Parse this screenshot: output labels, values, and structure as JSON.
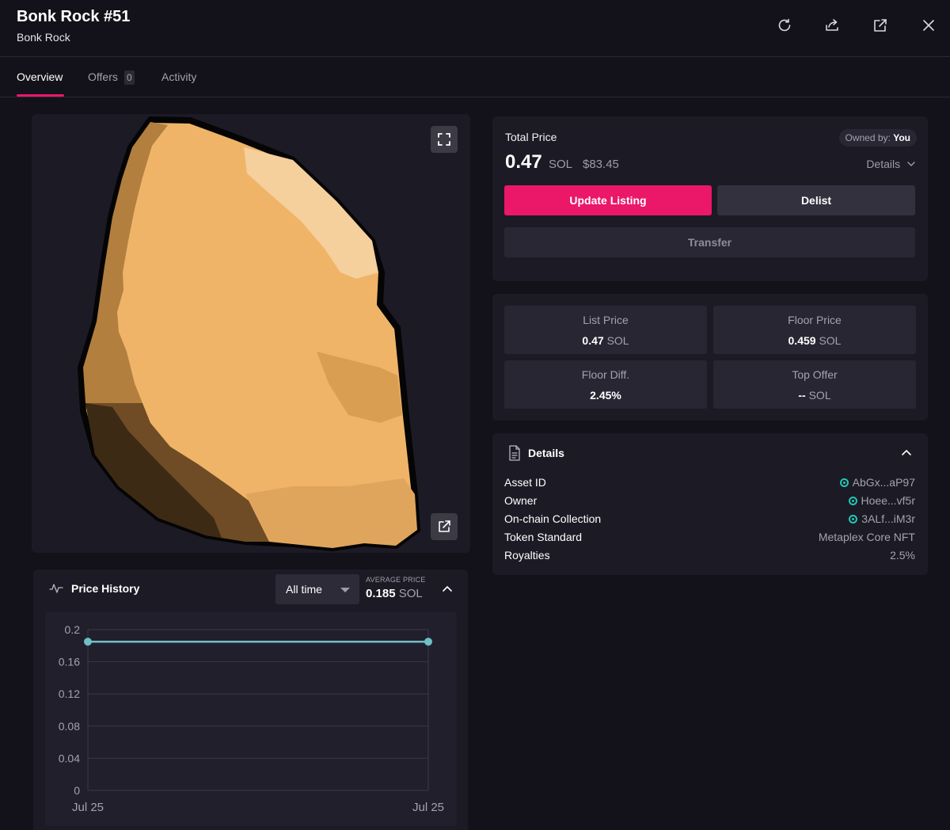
{
  "header": {
    "title": "Bonk Rock #51",
    "subtitle": "Bonk Rock",
    "icons": [
      "refresh-icon",
      "share-icon",
      "external-link-icon",
      "close-icon"
    ]
  },
  "tabs": [
    {
      "label": "Overview",
      "active": true
    },
    {
      "label": "Offers",
      "count": "0"
    },
    {
      "label": "Activity"
    }
  ],
  "listing": {
    "total_price_label": "Total Price",
    "owned_by_label": "Owned by:",
    "owned_by_value": "You",
    "price": "0.47",
    "unit": "SOL",
    "usd": "$83.45",
    "details_label": "Details",
    "update_label": "Update Listing",
    "delist_label": "Delist",
    "transfer_label": "Transfer",
    "accent_color": "#eb1769"
  },
  "stats": [
    {
      "label": "List Price",
      "value": "0.47",
      "unit": "SOL"
    },
    {
      "label": "Floor Price",
      "value": "0.459",
      "unit": "SOL"
    },
    {
      "label": "Floor Diff.",
      "value": "2.45%",
      "unit": ""
    },
    {
      "label": "Top Offer",
      "value": "--",
      "unit": "SOL"
    }
  ],
  "details": {
    "title": "Details",
    "rows": [
      {
        "key": "Asset ID",
        "value": "AbGx...aP97",
        "link": true
      },
      {
        "key": "Owner",
        "value": "Hoee...vf5r",
        "link": true
      },
      {
        "key": "On-chain Collection",
        "value": "3ALf...iM3r",
        "link": true
      },
      {
        "key": "Token Standard",
        "value": "Metaplex Core NFT",
        "link": false
      },
      {
        "key": "Royalties",
        "value": "2.5%",
        "link": false
      }
    ]
  },
  "price_history": {
    "title": "Price History",
    "range_selected": "All time",
    "avg_label": "AVERAGE PRICE",
    "avg_value": "0.185",
    "avg_unit": "SOL"
  },
  "chart_data": {
    "type": "line",
    "title": "",
    "xlabel": "",
    "ylabel": "",
    "x": [
      "Jul 25",
      "Jul 25"
    ],
    "series": [
      {
        "values": [
          0.185,
          0.185
        ],
        "color": "#6fbfc6"
      }
    ],
    "y_ticks": [
      "0.2",
      "0.16",
      "0.12",
      "0.08",
      "0.04",
      "0"
    ],
    "ylim": [
      0,
      0.2
    ],
    "grid": true
  }
}
